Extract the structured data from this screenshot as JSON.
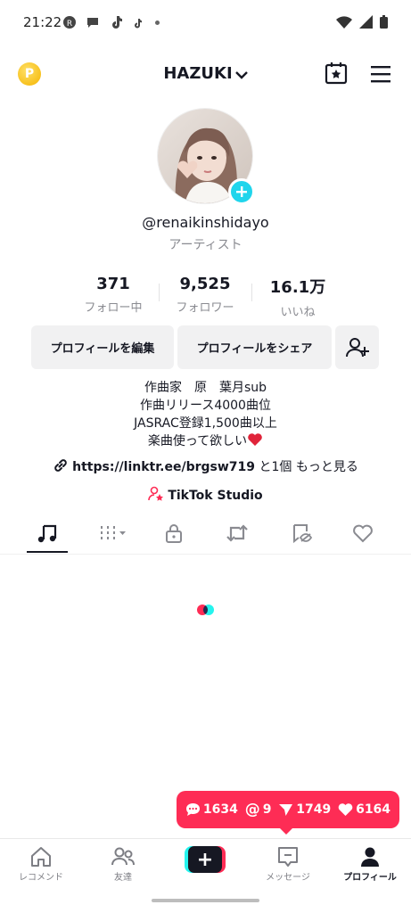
{
  "status_bar": {
    "time": "21:22"
  },
  "header": {
    "username": "HAZUKI",
    "coin_label": "P"
  },
  "profile": {
    "handle": "@renaikinshidayo",
    "role": "アーティスト",
    "stats": [
      {
        "value": "371",
        "label": "フォロー中"
      },
      {
        "value": "9,525",
        "label": "フォロワー"
      },
      {
        "value": "16.1万",
        "label": "いいね"
      }
    ],
    "buttons": {
      "edit": "プロフィールを編集",
      "share": "プロフィールをシェア"
    },
    "bio": [
      "作曲家　原　葉月sub",
      "作曲リリース4000曲位",
      "JASRAC登録1,500曲以上",
      "楽曲使って欲しい"
    ],
    "link": "https://linktr.ee/brgsw719",
    "link_suffix": "と1個",
    "more": "もっと見る",
    "studio": "TikTok Studio"
  },
  "notifications": {
    "comments": "1634",
    "mentions": "9",
    "shares": "1749",
    "likes": "6164"
  },
  "bottom_nav": {
    "home": "レコメンド",
    "friends": "友達",
    "create": "+",
    "inbox": "メッセージ",
    "profile": "プロフィール"
  },
  "colors": {
    "accent": "#fe2c55",
    "cyan": "#25f4ee",
    "badge": "#20d5ec"
  }
}
